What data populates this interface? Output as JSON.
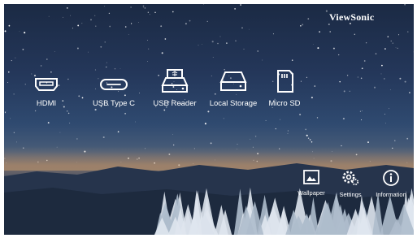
{
  "brand": "ViewSonic",
  "sources": [
    {
      "label": "HDMI",
      "icon": "hdmi-icon"
    },
    {
      "label": "USB Type C",
      "icon": "usb-type-c-icon"
    },
    {
      "label": "USB Reader",
      "icon": "usb-reader-icon"
    },
    {
      "label": "Local Storage",
      "icon": "local-storage-icon"
    },
    {
      "label": "Micro SD",
      "icon": "micro-sd-icon"
    }
  ],
  "functions": [
    {
      "label": "Wallpaper",
      "icon": "wallpaper-icon"
    },
    {
      "label": "Settings",
      "icon": "settings-icon"
    },
    {
      "label": "Information",
      "icon": "information-icon"
    }
  ]
}
